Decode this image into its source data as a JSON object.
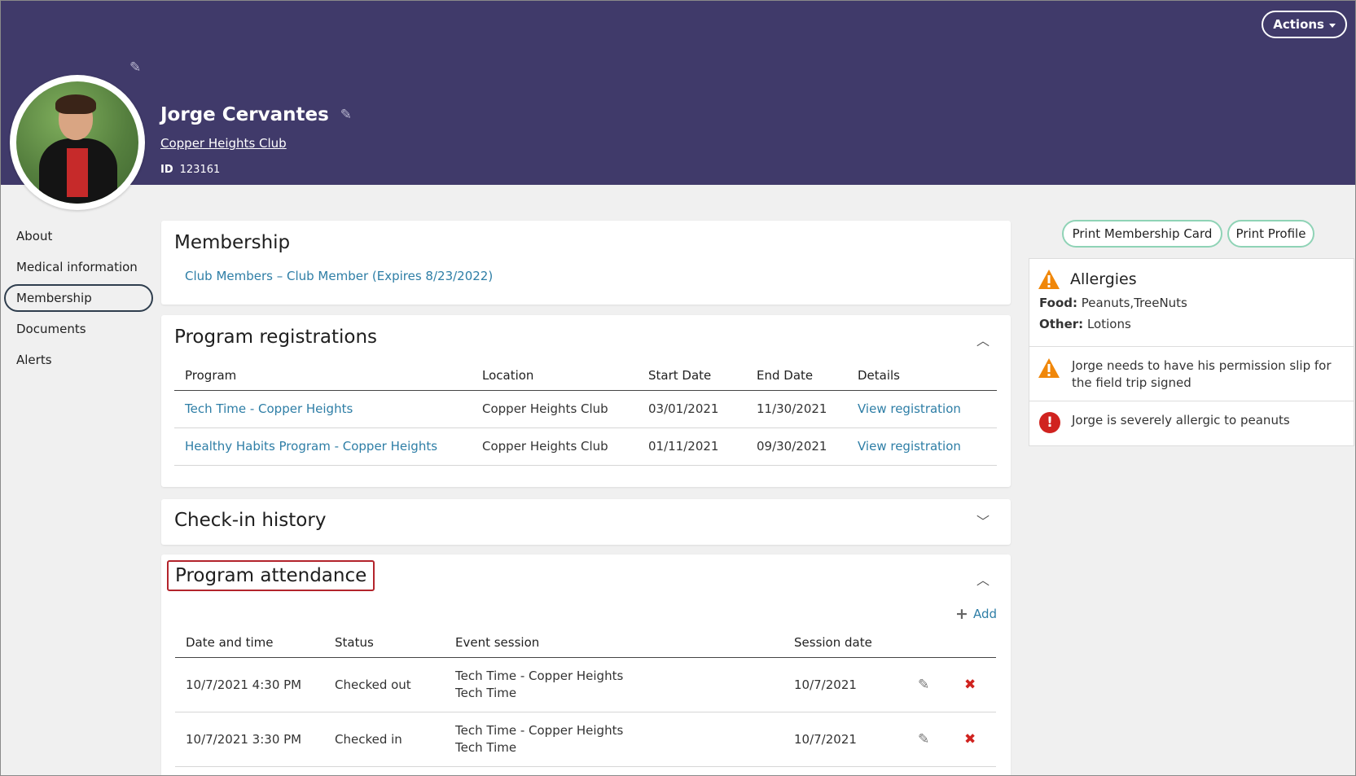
{
  "header": {
    "actions_label": "Actions",
    "name": "Jorge Cervantes",
    "club": "Copper Heights Club",
    "id_label": "ID",
    "id_value": "123161"
  },
  "sidebar": {
    "items": [
      {
        "label": "About"
      },
      {
        "label": "Medical information"
      },
      {
        "label": "Membership"
      },
      {
        "label": "Documents"
      },
      {
        "label": "Alerts"
      }
    ]
  },
  "membership": {
    "title": "Membership",
    "link": "Club Members – Club Member (Expires 8/23/2022)"
  },
  "registrations": {
    "title": "Program registrations",
    "columns": [
      "Program",
      "Location",
      "Start Date",
      "End Date",
      "Details"
    ],
    "rows": [
      {
        "program": "Tech Time - Copper Heights",
        "location": "Copper Heights Club",
        "start": "03/01/2021",
        "end": "11/30/2021",
        "details": "View registration"
      },
      {
        "program": "Healthy Habits Program - Copper Heights",
        "location": "Copper Heights Club",
        "start": "01/11/2021",
        "end": "09/30/2021",
        "details": "View registration"
      }
    ]
  },
  "checkin": {
    "title": "Check-in history"
  },
  "attendance": {
    "title": "Program attendance",
    "add_label": "Add",
    "columns": [
      "Date and time",
      "Status",
      "Event session",
      "Session date"
    ],
    "rows": [
      {
        "datetime": "10/7/2021 4:30 PM",
        "status": "Checked out",
        "session_line1": "Tech Time - Copper Heights",
        "session_line2": "Tech Time",
        "date": "10/7/2021"
      },
      {
        "datetime": "10/7/2021 3:30 PM",
        "status": "Checked in",
        "session_line1": "Tech Time - Copper Heights",
        "session_line2": "Tech Time",
        "date": "10/7/2021"
      }
    ]
  },
  "right": {
    "print_card_label": "Print Membership Card",
    "print_profile_label": "Print Profile",
    "allergies": {
      "title": "Allergies",
      "food_label": "Food:",
      "food_value": "Peanuts,TreeNuts",
      "other_label": "Other:",
      "other_value": "Lotions"
    },
    "alert_1": "Jorge needs to have his permission slip for the field trip signed",
    "alert_2": "Jorge is severely allergic to peanuts"
  },
  "icons": {
    "edit": "pencil-icon",
    "collapse": "chevron-up-icon",
    "expand": "chevron-down-icon",
    "add": "plus-icon",
    "delete": "x-icon",
    "warning": "warning-triangle-icon",
    "error": "error-circle-icon"
  },
  "colors": {
    "header_bg": "#403a6a",
    "link": "#2e7ea6",
    "print_border": "#8fd3b6",
    "highlight_box": "#b3242c",
    "warning": "#f0870a",
    "error": "#d0231f"
  }
}
